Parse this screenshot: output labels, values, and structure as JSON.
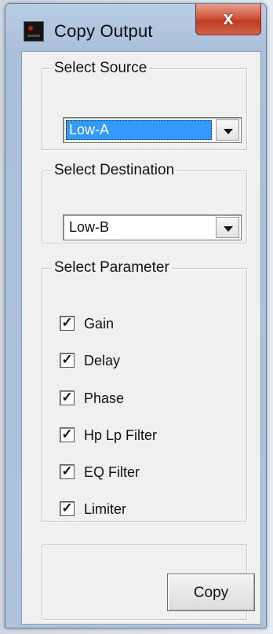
{
  "window": {
    "title": "Copy Output",
    "close_label": "x"
  },
  "source": {
    "legend": "Select Source",
    "value": "Low-A"
  },
  "destination": {
    "legend": "Select Destination",
    "value": "Low-B"
  },
  "parameters": {
    "legend": "Select Parameter",
    "items": [
      {
        "label": "Gain",
        "checked": true
      },
      {
        "label": "Delay",
        "checked": true
      },
      {
        "label": "Phase",
        "checked": true
      },
      {
        "label": "Hp Lp Filter",
        "checked": true
      },
      {
        "label": "EQ Filter",
        "checked": true
      },
      {
        "label": "Limiter",
        "checked": true
      }
    ],
    "check_glyph": "✓"
  },
  "actions": {
    "copy_label": "Copy"
  },
  "colors": {
    "selection": "#3399ff",
    "close_button": "#c8452d",
    "window_frame": "#aec3dc"
  }
}
